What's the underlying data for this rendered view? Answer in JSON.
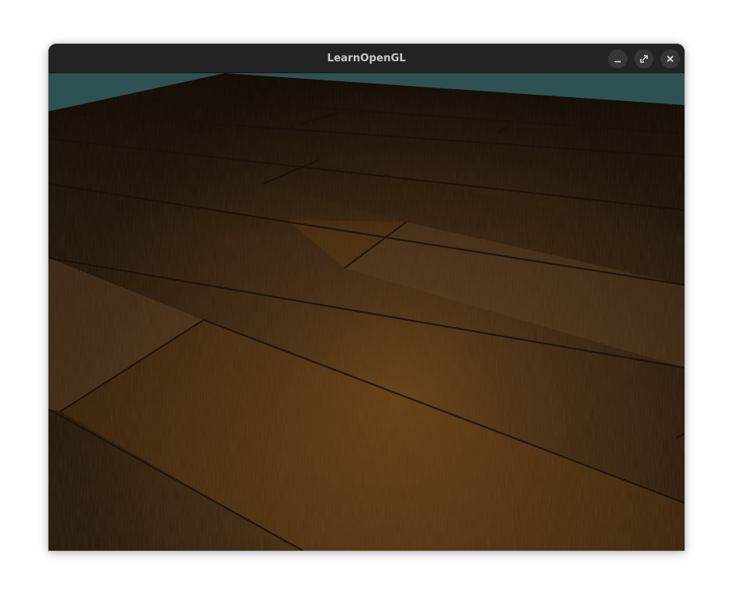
{
  "window": {
    "title": "LearnOpenGL"
  },
  "titlebar_buttons": [
    {
      "name": "minimize",
      "icon": "minimize-icon"
    },
    {
      "name": "maximize",
      "icon": "maximize-icon"
    },
    {
      "name": "close",
      "icon": "close-icon"
    }
  ],
  "scene": {
    "description_icon": "wood-floor-render",
    "clear_color": "#2e5253",
    "floor_base_color": "#3a2410",
    "light_highlight_color": "#7a4e1c"
  }
}
